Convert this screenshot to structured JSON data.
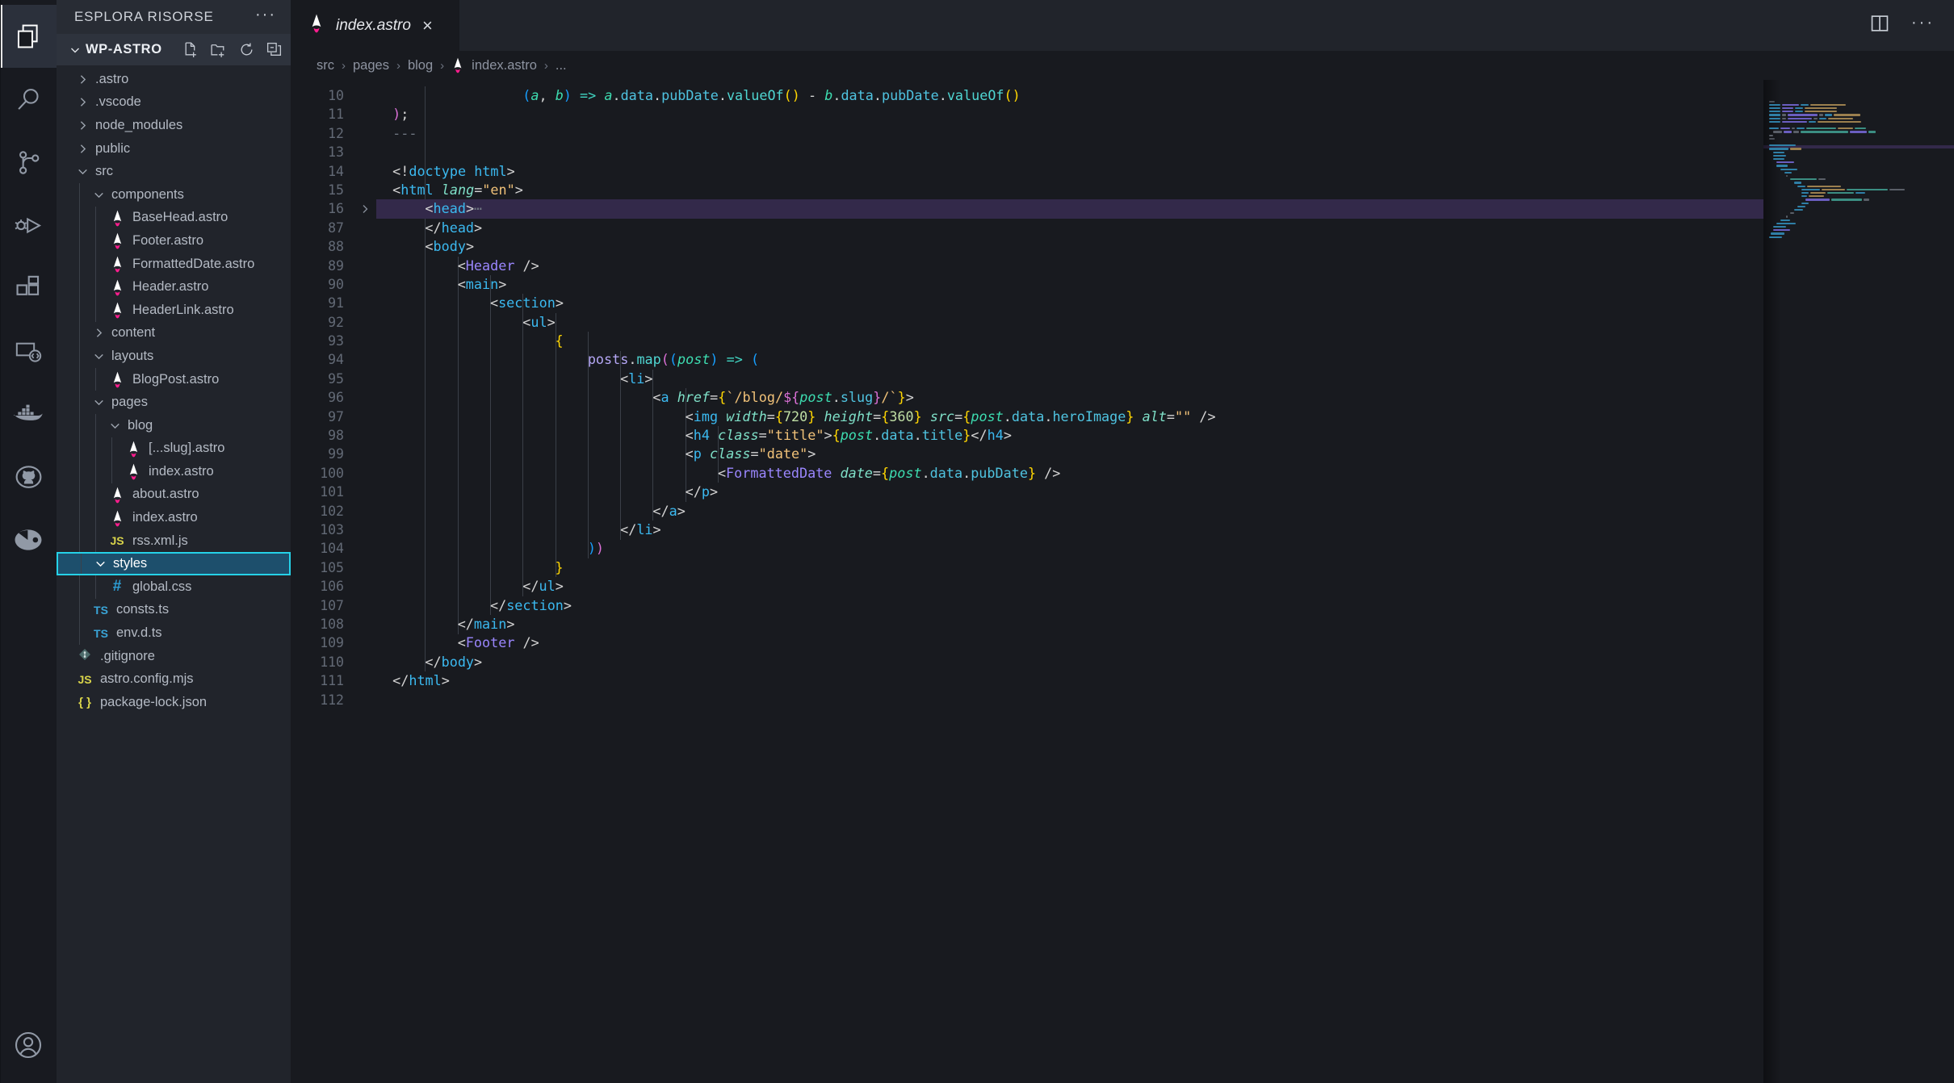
{
  "activitybar": {
    "items": [
      {
        "name": "explorer",
        "icon": "files-icon",
        "active": true
      },
      {
        "name": "search",
        "icon": "search-icon",
        "active": false
      },
      {
        "name": "source-control",
        "icon": "source-control-icon",
        "active": false
      },
      {
        "name": "run-and-debug",
        "icon": "run-debug-icon",
        "active": false
      },
      {
        "name": "extensions",
        "icon": "extensions-icon",
        "active": false
      },
      {
        "name": "remote-explorer",
        "icon": "remote-icon",
        "active": false
      },
      {
        "name": "docker",
        "icon": "docker-whale-icon",
        "active": false
      },
      {
        "name": "github",
        "icon": "github-icon",
        "active": false
      },
      {
        "name": "astro-tools",
        "icon": "pie-eye-icon",
        "active": false
      }
    ],
    "account_icon": "account-icon"
  },
  "sidebar": {
    "title": "ESPLORA RISORSE",
    "more_actions": "···",
    "root": {
      "name": "WP-ASTRO",
      "expanded": true,
      "actions": [
        {
          "label": "Nuovo file",
          "icon": "new-file-icon"
        },
        {
          "label": "Nuova cartella",
          "icon": "new-folder-icon"
        },
        {
          "label": "Aggiorna",
          "icon": "refresh-icon"
        },
        {
          "label": "Comprimi cartelle",
          "icon": "collapse-all-icon"
        }
      ]
    },
    "tree": [
      {
        "label": ".astro",
        "depth": 1,
        "kind": "folder",
        "state": "collapsed"
      },
      {
        "label": ".vscode",
        "depth": 1,
        "kind": "folder",
        "state": "collapsed"
      },
      {
        "label": "node_modules",
        "depth": 1,
        "kind": "folder",
        "state": "collapsed"
      },
      {
        "label": "public",
        "depth": 1,
        "kind": "folder",
        "state": "collapsed"
      },
      {
        "label": "src",
        "depth": 1,
        "kind": "folder",
        "state": "expanded"
      },
      {
        "label": "components",
        "depth": 2,
        "kind": "folder",
        "state": "expanded"
      },
      {
        "label": "BaseHead.astro",
        "depth": 3,
        "kind": "astro"
      },
      {
        "label": "Footer.astro",
        "depth": 3,
        "kind": "astro"
      },
      {
        "label": "FormattedDate.astro",
        "depth": 3,
        "kind": "astro"
      },
      {
        "label": "Header.astro",
        "depth": 3,
        "kind": "astro"
      },
      {
        "label": "HeaderLink.astro",
        "depth": 3,
        "kind": "astro"
      },
      {
        "label": "content",
        "depth": 2,
        "kind": "folder",
        "state": "collapsed"
      },
      {
        "label": "layouts",
        "depth": 2,
        "kind": "folder",
        "state": "expanded"
      },
      {
        "label": "BlogPost.astro",
        "depth": 3,
        "kind": "astro"
      },
      {
        "label": "pages",
        "depth": 2,
        "kind": "folder",
        "state": "expanded"
      },
      {
        "label": "blog",
        "depth": 3,
        "kind": "folder",
        "state": "expanded"
      },
      {
        "label": "[...slug].astro",
        "depth": 4,
        "kind": "astro"
      },
      {
        "label": "index.astro",
        "depth": 4,
        "kind": "astro"
      },
      {
        "label": "about.astro",
        "depth": 3,
        "kind": "astro"
      },
      {
        "label": "index.astro",
        "depth": 3,
        "kind": "astro"
      },
      {
        "label": "rss.xml.js",
        "depth": 3,
        "kind": "js"
      },
      {
        "label": "styles",
        "depth": 2,
        "kind": "folder",
        "state": "expanded",
        "selected": true
      },
      {
        "label": "global.css",
        "depth": 3,
        "kind": "css"
      },
      {
        "label": "consts.ts",
        "depth": 2,
        "kind": "ts"
      },
      {
        "label": "env.d.ts",
        "depth": 2,
        "kind": "ts"
      },
      {
        "label": ".gitignore",
        "depth": 1,
        "kind": "git"
      },
      {
        "label": "astro.config.mjs",
        "depth": 1,
        "kind": "js"
      },
      {
        "label": "package-lock.json",
        "depth": 1,
        "kind": "json"
      }
    ]
  },
  "editor": {
    "tab": {
      "label": "index.astro",
      "icon": "astro-file-icon",
      "close": "×",
      "preview": true
    },
    "actions": [
      {
        "name": "split-editor",
        "icon": "split-editor-icon"
      },
      {
        "name": "more-actions",
        "icon": "more-dots-icon",
        "label": "···"
      }
    ],
    "breadcrumb": [
      "src",
      "pages",
      "blog",
      "index.astro",
      "..."
    ],
    "breadcrumb_separator": "›",
    "lines": [
      {
        "n": 10,
        "fold": null,
        "highlight": false
      },
      {
        "n": 11,
        "fold": null,
        "highlight": false
      },
      {
        "n": 12,
        "fold": null,
        "highlight": false
      },
      {
        "n": 13,
        "fold": null,
        "highlight": false
      },
      {
        "n": 14,
        "fold": null,
        "highlight": false
      },
      {
        "n": 15,
        "fold": null,
        "highlight": false
      },
      {
        "n": 16,
        "fold": "collapsed",
        "highlight": true
      },
      {
        "n": 87,
        "fold": null,
        "highlight": false
      },
      {
        "n": 88,
        "fold": null,
        "highlight": false
      },
      {
        "n": 89,
        "fold": null,
        "highlight": false
      },
      {
        "n": 90,
        "fold": null,
        "highlight": false
      },
      {
        "n": 91,
        "fold": null,
        "highlight": false
      },
      {
        "n": 92,
        "fold": null,
        "highlight": false
      },
      {
        "n": 93,
        "fold": null,
        "highlight": false
      },
      {
        "n": 94,
        "fold": null,
        "highlight": false
      },
      {
        "n": 95,
        "fold": null,
        "highlight": false
      },
      {
        "n": 96,
        "fold": null,
        "highlight": false
      },
      {
        "n": 97,
        "fold": null,
        "highlight": false
      },
      {
        "n": 98,
        "fold": null,
        "highlight": false
      },
      {
        "n": 99,
        "fold": null,
        "highlight": false
      },
      {
        "n": 100,
        "fold": null,
        "highlight": false
      },
      {
        "n": 101,
        "fold": null,
        "highlight": false
      },
      {
        "n": 102,
        "fold": null,
        "highlight": false
      },
      {
        "n": 103,
        "fold": null,
        "highlight": false
      },
      {
        "n": 104,
        "fold": null,
        "highlight": false
      },
      {
        "n": 105,
        "fold": null,
        "highlight": false
      },
      {
        "n": 106,
        "fold": null,
        "highlight": false
      },
      {
        "n": 107,
        "fold": null,
        "highlight": false
      },
      {
        "n": 108,
        "fold": null,
        "highlight": false
      },
      {
        "n": 109,
        "fold": null,
        "highlight": false
      },
      {
        "n": 110,
        "fold": null,
        "highlight": false
      },
      {
        "n": 111,
        "fold": null,
        "highlight": false
      },
      {
        "n": 112,
        "fold": null,
        "highlight": false
      }
    ],
    "code_text": [
      "    (a, b) => a.data.pubDate.valueOf() - b.data.pubDate.valueOf()",
      "  );",
      "  ---",
      "",
      "  <!doctype html>",
      "  <html lang=\"en\">",
      "      <head> ⋯",
      "      </head>",
      "      <body>",
      "          <Header />",
      "          <main>",
      "              <section>",
      "                  <ul>",
      "                      {",
      "                          posts.map((post) => (",
      "                              <li>",
      "                                  <a href={`/blog/${post.slug}/`}>",
      "                                      <img width={720} height={360} src={post.data.heroImage} alt=\"\" />",
      "                                      <h4 class=\"title\">{post.data.title}</h4>",
      "                                      <p class=\"date\">",
      "                                          <FormattedDate date={post.data.pubDate} />",
      "                                      </p>",
      "                                  </a>",
      "                              </li>",
      "                          ))",
      "                      }",
      "                  </ul>",
      "              </section>",
      "          </main>",
      "          <Footer />",
      "      </body>",
      "  </html>",
      ""
    ]
  },
  "colors": {
    "activitybar_bg": "#181a20",
    "sidebar_bg": "#21242b",
    "editor_bg": "#181a1f",
    "tab_active_bg": "#181a1f",
    "selection_border": "#25d2e8",
    "selection_bg": "#1d4f6c",
    "fold_highlight": "#33294a",
    "astro_accent": "#ff1d8e"
  }
}
